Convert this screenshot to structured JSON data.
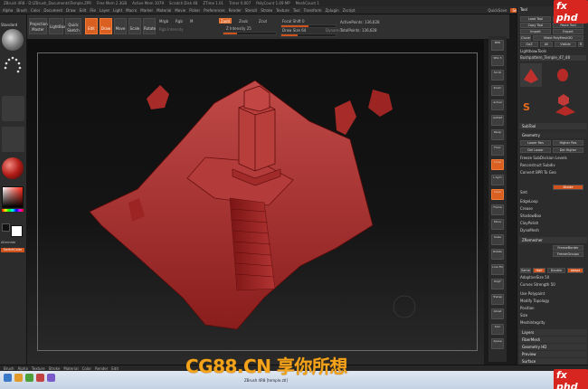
{
  "app": {
    "title": "ZBrush 4R8 - D:\\ZBrush_Documents\\Temple.ZPR",
    "free_mem": "Free Mem 2.3GB",
    "active_mem": "Active Mem 1079",
    "scratch": "Scratch Disk 48",
    "ztime": "ZTime 1.01",
    "timer": "Timer 0.007",
    "polycount": "PolyCount 1.09 MP",
    "meshcount": "MeshCount 1"
  },
  "menubar": {
    "items": [
      "Alpha",
      "Brush",
      "Color",
      "Document",
      "Draw",
      "Edit",
      "File",
      "Layer",
      "Light",
      "Macro",
      "Marker",
      "Material",
      "Movie",
      "Picker",
      "Preferences",
      "Render",
      "Stencil",
      "Stroke",
      "Texture",
      "Tool",
      "Transform",
      "Zplugin",
      "Zscript"
    ],
    "quicksave_label": "QuickSave",
    "see_through_label": "See-through 0",
    "menus_label": "Menus",
    "default_script": "DefaultZScript"
  },
  "shelf": {
    "projection_master": "Projection Master",
    "lightbox": "LightBox",
    "quick_sketch": "Quick Sketch",
    "edit_label": "Edit",
    "draw_label": "Draw",
    "move_label": "Move",
    "scale_label": "Scale",
    "rotate_label": "Rotate",
    "mrgb": "Mrgb",
    "rgb": "Rgb",
    "m": "M",
    "zadd": "Zadd",
    "zsub": "Zsub",
    "zcut": "Zcut",
    "rgb_intensity": "Rgb Intensity",
    "z_intensity": "Z Intensity 25",
    "z_intensity_value": 25,
    "focal_shift": "Focal Shift 0",
    "draw_size": "Draw Size 64",
    "dynamic": "Dynamic",
    "active_points": "ActivePoints: 136,628",
    "total_points": "TotalPoints: 136,628"
  },
  "left_tray": {
    "brush_label": "Standard",
    "alpha_label": "Alpha Off",
    "texture_label": "Texture Off",
    "material_label": "MatCap Red",
    "gradient_label": "Gradient",
    "switch_color": "SwitchColor",
    "alternate": "Alternate",
    "accent": "#d0521d"
  },
  "right_shelf": {
    "items": [
      "BPR",
      "SPix 3",
      "Scroll",
      "Zoom",
      "Actual",
      "AAHalf",
      "Persp",
      "Floor",
      "Local",
      "L.Sym",
      "Gxyz",
      "Frame",
      "Move",
      "Scale",
      "Rotate",
      "Line Fill",
      "PolyF",
      "Transp",
      "Ghost",
      "Solo",
      "Xpose"
    ],
    "active": [
      "Local",
      "Gxyz"
    ]
  },
  "tool_palette": {
    "title": "Tool",
    "load_tool": "Load Tool",
    "save_as": "Save As",
    "copy_tool": "Copy Tool",
    "paste_tool": "Paste Tool",
    "import": "Import",
    "export": "Export",
    "clone": "Clone",
    "make_polymesh": "Make PolyMesh3D",
    "goz": "GoZ",
    "all": "All",
    "visible": "Visible",
    "r": "R",
    "lightbox_tools": "Lightbox▸Tools",
    "current_tool": "Bushpattern_Temple_47_48",
    "thumbs": [
      "Cylinder3D",
      "PolyMesh3D",
      "SimpleBrush",
      "Temple"
    ],
    "subtool": "SubTool",
    "geometry": "Geometry",
    "array_mesh": "ArrayMesh",
    "nano_mesh": "NanoMesh",
    "layers": "Layers",
    "fibermesh": "FiberMesh",
    "geometry_hd": "Geometry HD",
    "preview": "Preview",
    "surface": "Surface",
    "deformation": "Deformation",
    "masking": "Masking",
    "visibility": "Visibility",
    "polygroups": "Polygroups",
    "contact": "Contact",
    "morph_target": "Morph Target",
    "polypaint": "Polypaint",
    "uv_map": "UV Map",
    "texture_map": "Texture Map",
    "displacement_map": "Displacement Map",
    "normal_map": "Normal Map",
    "vector_displacement_map": "Vector Displacement Map",
    "display_properties": "Display Properties",
    "unified_skin": "Unified Skin",
    "initialize": "Initialize",
    "import2": "Import",
    "export2": "Export",
    "lower_res": "Lower Res",
    "higher_res": "Higher Res",
    "sdiv": "SDiv",
    "del_lower": "Del Lower",
    "del_higher": "Del Higher",
    "freeze_subdiv": "Freeze SubDivision Levels",
    "reconstruct_subdiv": "Reconstruct Subdiv",
    "convert_bpr": "Convert BPR To Geo",
    "divide": "Divide",
    "smt": "Smt",
    "suv": "Suv",
    "reuv": "ReUV",
    "dynamic_subdiv": "Dynamic Subdiv",
    "edge_loop": "EdgeLoop",
    "crease": "Crease",
    "shadowbox": "ShadowBox",
    "claypolish": "ClayPolish",
    "dynamesh": "DynaMesh",
    "tessimate": "Tessimate",
    "zremesher": "ZRemesher",
    "freeze_border": "FreezeBorder",
    "freeze_groups": "FreezeGroups",
    "same": "Same",
    "half": "Half",
    "double": "Double",
    "adapt": "Adapt",
    "adaptive_size": "AdaptiveSize 50",
    "curves_strength": "Curves Strength 50",
    "use_polypaint": "Use Polypaint",
    "modify_topology": "Modify Topology",
    "position": "Position",
    "size": "Size",
    "mesh_integrity": "MeshIntegrity"
  },
  "bottom": {
    "items": [
      "Brush",
      "Alpha",
      "Texture",
      "Stroke",
      "Material",
      "Color",
      "Render",
      "Edit"
    ],
    "status": "ZBrush 4R8 [temple.ztl]"
  },
  "watermark": {
    "text": "CG88.CN 享你所想",
    "logo_top": "fx phd",
    "logo_bottom": "fx phd"
  }
}
